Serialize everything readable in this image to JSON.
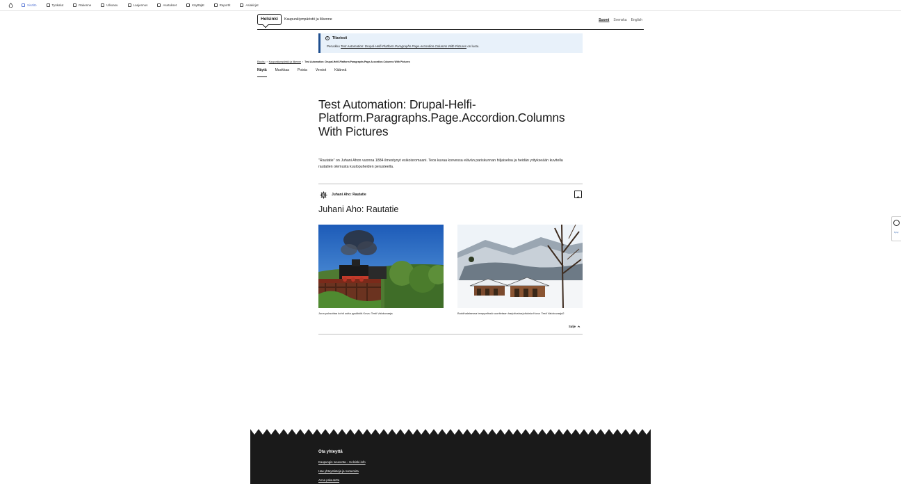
{
  "toolbar": {
    "items": [
      {
        "label": "Sisältö",
        "icon": "file-icon",
        "active": true
      },
      {
        "label": "Työkalut",
        "icon": "calendar-icon"
      },
      {
        "label": "Rakenne",
        "icon": "layers-icon"
      },
      {
        "label": "Ulkoasu",
        "icon": "brush-icon"
      },
      {
        "label": "Laajennus",
        "icon": "puzzle-icon"
      },
      {
        "label": "Asetukset",
        "icon": "wrench-icon"
      },
      {
        "label": "Käyttäjät",
        "icon": "user-icon"
      },
      {
        "label": "Raportit",
        "icon": "chart-icon"
      },
      {
        "label": "Asiakirjat",
        "icon": "help-icon"
      }
    ]
  },
  "header": {
    "logo": "Helsinki",
    "site_name": "Kaupunkiympäristö ja liikenne",
    "languages": [
      "Suomi",
      "Svenska",
      "English"
    ]
  },
  "notice": {
    "title": "Tilaviesti",
    "body_prefix": "Peruskku ",
    "body_link": "Test Automation: Drupal-Helfi-Platform.Paragraphs.Page.Accordion.Columns With Pictures",
    "body_suffix": " on luotu."
  },
  "breadcrumb": {
    "home": "Etusivu",
    "parent": "Kaupunkiympäristö ja liikenne",
    "current": "Test Automation: Drupal-Helfi-Platform.Paragraphs.Page.Accordion.Columns With Pictures"
  },
  "tabs": [
    "Näytä",
    "Muokkaa",
    "Poista",
    "Versiot",
    "Käännä"
  ],
  "page": {
    "title": "Test Automation: Drupal-Helfi-Platform.Paragraphs.Page.Accordion.Columns With Pictures",
    "lead": "\"Rautatie\" on Juhani Ahon vuonna 1884 ilmestynyt esikoisromaani. Teos kuvaa korvessa elävän pariskunnan hiljaiseloa ja heidän yritykseään kuvitella rautatien olemusta kuulopuheiden perusteella."
  },
  "accordion": {
    "heading": "Juhani Aho: Rautatie",
    "content_title": "Juhani Aho: Rautatie",
    "images": [
      {
        "caption": "Juna puksuttaa kohti uutta pysäkkiä Kuva: Testi Valokuvaaja"
      },
      {
        "caption": "Buddhalaisessa temppelissä suoritetaan harjoitusharjoituksia Kuva: Testi Valokuvaaja2"
      }
    ],
    "close_label": "Sulje"
  },
  "footer": {
    "title": "Ota yhteyttä",
    "links": [
      "Kaupungin neuvonta – Helsinki-info",
      "Hae yhteystietoja ja numeroita",
      "Anna palautetta"
    ]
  },
  "side_widget": {
    "label": "Kysy"
  },
  "colors": {
    "accent": "#1f4f8f",
    "notice_bg": "#e8f1fa",
    "footer_bg": "#1a1a1a",
    "toolbar_active": "#5b7ad6"
  }
}
